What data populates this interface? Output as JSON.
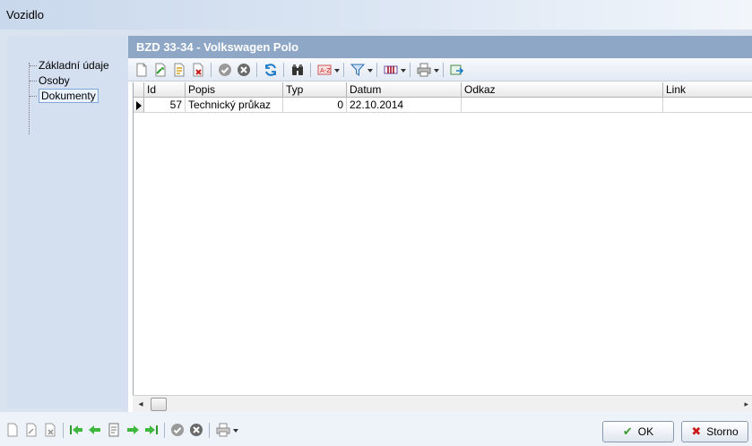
{
  "window": {
    "title": "Vozidlo"
  },
  "tree": {
    "items": [
      {
        "label": "Základní údaje",
        "selected": false
      },
      {
        "label": "Osoby",
        "selected": false
      },
      {
        "label": "Dokumenty",
        "selected": true
      }
    ]
  },
  "panel": {
    "header": "BZD 33-34  -  Volkswagen Polo"
  },
  "grid": {
    "columns": [
      "Id",
      "Popis",
      "Typ",
      "Datum",
      "Odkaz",
      "Link"
    ],
    "rows": [
      {
        "id": "57",
        "popis": "Technický průkaz",
        "typ": "0",
        "datum": "22.10.2014",
        "odkaz": "",
        "link": ""
      }
    ]
  },
  "buttons": {
    "ok": "OK",
    "storno": "Storno"
  },
  "colors": {
    "header_bg": "#8fa7c6",
    "tree_bg": "#d4dff0",
    "ok_check": "#3a9a2a",
    "storno_x": "#cc1a1a"
  }
}
